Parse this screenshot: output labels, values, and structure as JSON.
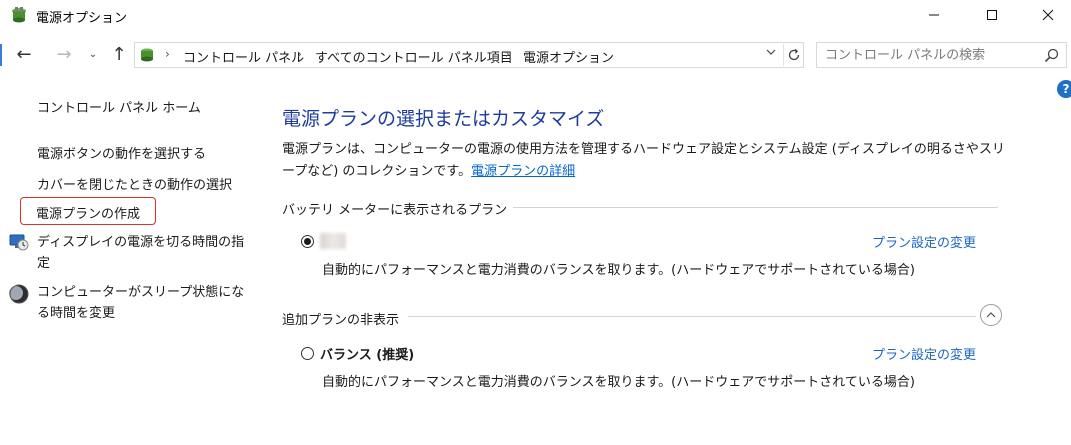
{
  "window": {
    "title": "電源オプション"
  },
  "nav": {
    "back_glyph": "←",
    "forward_glyph": "→",
    "recent_glyph": "⌄",
    "up_glyph": "↑"
  },
  "address": {
    "crumbs": [
      "コントロール パネル",
      "すべてのコントロール パネル項目",
      "電源オプション"
    ],
    "separator": "›"
  },
  "search": {
    "placeholder": "コントロール パネルの検索"
  },
  "sidebar": {
    "home": "コントロール パネル ホーム",
    "items": [
      "電源ボタンの動作を選択する",
      "カバーを閉じたときの動作の選択",
      "電源プランの作成",
      "ディスプレイの電源を切る時間の指定",
      "コンピューターがスリープ状態になる時間を変更"
    ]
  },
  "main": {
    "title": "電源プランの選択またはカスタマイズ",
    "description": "電源プランは、コンピューターの電源の使用方法を管理するハードウェア設定とシステム設定 (ディスプレイの明るさやスリープなど) のコレクションです。",
    "details_link": "電源プランの詳細",
    "section_battery": "バッテリ メーターに表示されるプラン",
    "section_additional": "追加プランの非表示",
    "plans": [
      {
        "name": "",
        "selected": true,
        "change_link": "プラン設定の変更",
        "description": "自動的にパフォーマンスと電力消費のバランスを取ります。(ハードウェアでサポートされている場合)"
      },
      {
        "name": "バランス (推奨)",
        "selected": false,
        "change_link": "プラン設定の変更",
        "description": "自動的にパフォーマンスと電力消費のバランスを取ります。(ハードウェアでサポートされている場合)"
      }
    ]
  },
  "help": {
    "glyph": "?"
  },
  "colors": {
    "title_blue": "#1e3c9c",
    "link_blue": "#1a66c6",
    "highlight_red": "#e0302a"
  }
}
